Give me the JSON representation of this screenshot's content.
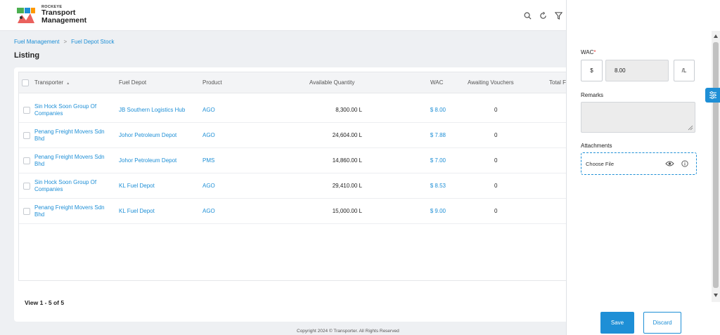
{
  "header": {
    "brand_small": "ROCKEYE",
    "brand_line1": "Transport",
    "brand_line2": "Management"
  },
  "breadcrumb": {
    "item1": "Fuel Management",
    "separator": ">",
    "item2": "Fuel Depot Stock"
  },
  "page_title": "Listing",
  "table": {
    "headers": {
      "transporter": "Transporter",
      "sort_indicator": "▲",
      "fuel_depot": "Fuel Depot",
      "product": "Product",
      "available_quantity": "Available Quantity",
      "wac": "WAC",
      "awaiting_vouchers": "Awaiting Vouchers",
      "total": "Total F"
    },
    "rows": [
      {
        "transporter_line1": "Sin Hock Soon Group Of",
        "transporter_line2": "Companies",
        "depot": "JB Southern Logistics Hub",
        "product": "AGO",
        "quantity": "8,300.00 L",
        "wac": "$ 8.00",
        "awaiting": "0"
      },
      {
        "transporter_line1": "Penang Freight Movers Sdn",
        "transporter_line2": "Bhd",
        "depot": "Johor Petroleum Depot",
        "product": "AGO",
        "quantity": "24,604.00 L",
        "wac": "$ 7.88",
        "awaiting": "0"
      },
      {
        "transporter_line1": "Penang Freight Movers Sdn",
        "transporter_line2": "Bhd",
        "depot": "Johor Petroleum Depot",
        "product": "PMS",
        "quantity": "14,860.00 L",
        "wac": "$ 7.00",
        "awaiting": "0"
      },
      {
        "transporter_line1": "Sin Hock Soon Group Of",
        "transporter_line2": "Companies",
        "depot": "KL Fuel Depot",
        "product": "AGO",
        "quantity": "29,410.00 L",
        "wac": "$ 8.53",
        "awaiting": "0"
      },
      {
        "transporter_line1": "Penang Freight Movers Sdn",
        "transporter_line2": "Bhd",
        "depot": "KL Fuel Depot",
        "product": "AGO",
        "quantity": "15,000.00 L",
        "wac": "$ 9.00",
        "awaiting": "0"
      }
    ]
  },
  "pagination_info": "View 1 - 5 of 5",
  "copyright": "Copyright 2024 © Transporter. All Rights Reserved",
  "panel": {
    "wac_label": "WAC",
    "required_mark": "*",
    "currency_prefix": "$",
    "wac_value": "8.00",
    "unit_suffix": "/L",
    "remarks_label": "Remarks",
    "attachments_label": "Attachments",
    "choose_file": "Choose File",
    "save_label": "Save",
    "discard_label": "Discard"
  },
  "colors": {
    "accent": "#1e8fd6",
    "required": "#e53935"
  }
}
